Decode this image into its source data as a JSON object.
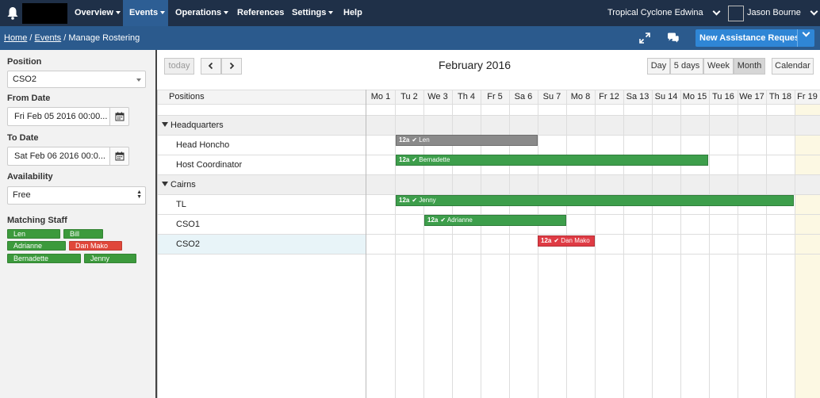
{
  "nav": {
    "items": [
      {
        "label": "Overview",
        "caret": true
      },
      {
        "label": "Events",
        "caret": true,
        "active": true
      },
      {
        "label": "Operations",
        "caret": true
      },
      {
        "label": "References",
        "caret": false
      },
      {
        "label": "Settings",
        "caret": true
      },
      {
        "label": "Help",
        "caret": false
      }
    ],
    "event_name": "Tropical Cyclone Edwina",
    "user_name": "Jason Bourne"
  },
  "breadcrumb": {
    "home": "Home",
    "events": "Events",
    "current": "Manage Rostering",
    "sep": "/"
  },
  "new_request_label": "New Assistance Request",
  "filters": {
    "position_label": "Position",
    "position_value": "CSO2",
    "from_label": "From Date",
    "from_value": "Fri Feb 05 2016 00:00...",
    "to_label": "To Date",
    "to_value": "Sat Feb 06 2016 00:0...",
    "availability_label": "Availability",
    "availability_value": "Free",
    "matching_label": "Matching Staff"
  },
  "matching_staff": [
    {
      "name": "Len",
      "status": "available"
    },
    {
      "name": "Bill",
      "status": "available"
    },
    {
      "name": "Adrianne",
      "status": "available"
    },
    {
      "name": "Dan Mako",
      "status": "unavailable"
    },
    {
      "name": "Bernadette",
      "status": "available"
    },
    {
      "name": "Jenny",
      "status": "available"
    }
  ],
  "calendar": {
    "today_label": "today",
    "prev_icon": "chevron-left-icon",
    "next_icon": "chevron-right-icon",
    "title": "February 2016",
    "views": [
      "Day",
      "5 days",
      "Week",
      "Month"
    ],
    "active_view": "Month",
    "calendar_button": "Calendar",
    "positions_header": "Positions",
    "days": [
      "Mo 1",
      "Tu 2",
      "We 3",
      "Th 4",
      "Fr 5",
      "Sa 6",
      "Su 7",
      "Mo 8",
      "Fr 12",
      "Sa 13",
      "Su 14",
      "Mo 15",
      "Tu 16",
      "We 17",
      "Th 18",
      "Fr 19"
    ],
    "groups": [
      {
        "name": "Headquarters",
        "resources": [
          "Head Honcho",
          "Host Coordinator"
        ]
      },
      {
        "name": "Cairns",
        "resources": [
          "TL",
          "CSO1",
          "CSO2"
        ]
      }
    ],
    "events": [
      {
        "resource": "Head Honcho",
        "time": "12a",
        "name": "Len",
        "status": "unavailable-grey"
      },
      {
        "resource": "Host Coordinator",
        "time": "12a",
        "name": "Bernadette",
        "status": "confirmed"
      },
      {
        "resource": "TL",
        "time": "12a",
        "name": "Jenny",
        "status": "confirmed"
      },
      {
        "resource": "CSO1",
        "time": "12a",
        "name": "Adrianne",
        "status": "confirmed"
      },
      {
        "resource": "CSO2",
        "time": "12a",
        "name": "Dan Mako",
        "status": "conflict"
      }
    ]
  },
  "colors": {
    "nav_bg": "#1f3048",
    "subbar_bg": "#2b5a8d",
    "accent": "#2f86d6",
    "staff_available": "#3c9a3c",
    "staff_unavailable": "#e0473a",
    "event_grey": "#8a8a8a",
    "event_green": "#3d9e4b",
    "event_red": "#df3b44",
    "today_highlight": "#fcf8e3"
  }
}
